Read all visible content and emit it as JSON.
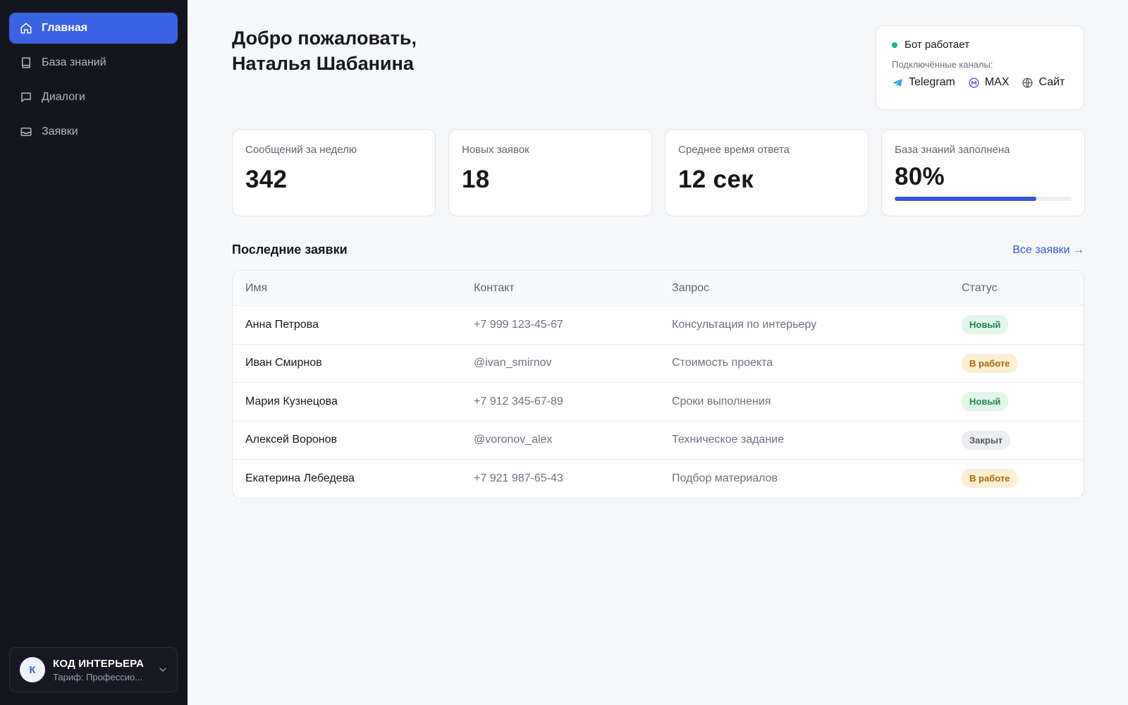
{
  "sidebar": {
    "items": [
      {
        "label": "Главная",
        "icon": "home-icon",
        "active": true
      },
      {
        "label": "База знаний",
        "icon": "book-icon",
        "active": false
      },
      {
        "label": "Диалоги",
        "icon": "chat-icon",
        "active": false
      },
      {
        "label": "Заявки",
        "icon": "inbox-icon",
        "active": false
      }
    ],
    "account": {
      "initial": "К",
      "name": "КОД ИНТЕРЬЕРА",
      "plan": "Тариф: Профессио..."
    }
  },
  "header": {
    "welcome_line1": "Добро пожаловать,",
    "welcome_line2": "Наталья Шабанина"
  },
  "bot": {
    "status": "Бот работает",
    "status_color": "#14b87a",
    "channels_label": "Подключённые каналы:",
    "channels": [
      {
        "name": "Telegram",
        "icon": "telegram-icon"
      },
      {
        "name": "MAX",
        "icon": "max-icon"
      },
      {
        "name": "Сайт",
        "icon": "globe-icon"
      }
    ]
  },
  "stats": [
    {
      "label": "Сообщений за неделю",
      "value": "342"
    },
    {
      "label": "Новых заявок",
      "value": "18"
    },
    {
      "label": "Среднее время ответа",
      "value": "12 сек"
    },
    {
      "label": "База знаний заполнена",
      "value": "80%",
      "progress": 0.8
    }
  ],
  "requests": {
    "title": "Последние заявки",
    "all_link": "Все заявки →",
    "columns": [
      "Имя",
      "Контакт",
      "Запрос",
      "Статус"
    ],
    "rows": [
      {
        "name": "Анна Петрова",
        "contact": "+7 999 123-45-67",
        "request": "Консультация по интерьеру",
        "status": "Новый",
        "status_type": "new"
      },
      {
        "name": "Иван Смирнов",
        "contact": "@ivan_smirnov",
        "request": "Стоимость проекта",
        "status": "В работе",
        "status_type": "work"
      },
      {
        "name": "Мария Кузнецова",
        "contact": "+7 912 345-67-89",
        "request": "Сроки выполнения",
        "status": "Новый",
        "status_type": "new"
      },
      {
        "name": "Алексей Воронов",
        "contact": "@voronov_alex",
        "request": "Техническое задание",
        "status": "Закрыт",
        "status_type": "closed"
      },
      {
        "name": "Екатерина Лебедева",
        "contact": "+7 921 987-65-43",
        "request": "Подбор материалов",
        "status": "В работе",
        "status_type": "work"
      }
    ]
  },
  "colors": {
    "accent": "#3a63e4",
    "sidebar_bg": "#14151f",
    "link": "#3a57d6"
  }
}
